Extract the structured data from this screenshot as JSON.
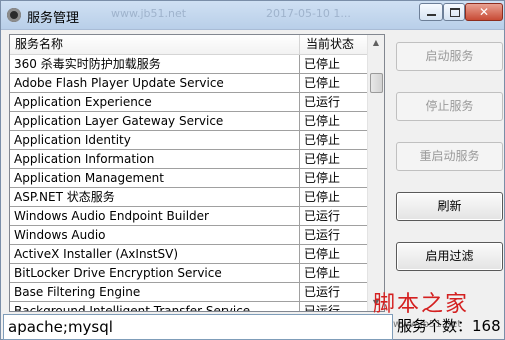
{
  "window": {
    "title": "服务管理",
    "ghost_text_1": "www.jb51.net",
    "ghost_text_2": "2017-05-10 1..."
  },
  "list": {
    "headers": {
      "name": "服务名称",
      "status": "当前状态"
    },
    "rows": [
      {
        "name": "360 杀毒实时防护加载服务",
        "status": "已停止"
      },
      {
        "name": "Adobe Flash Player Update Service",
        "status": "已停止"
      },
      {
        "name": "Application Experience",
        "status": "已运行"
      },
      {
        "name": "Application Layer Gateway Service",
        "status": "已停止"
      },
      {
        "name": "Application Identity",
        "status": "已停止"
      },
      {
        "name": "Application Information",
        "status": "已停止"
      },
      {
        "name": "Application Management",
        "status": "已停止"
      },
      {
        "name": "ASP.NET 状态服务",
        "status": "已停止"
      },
      {
        "name": "Windows Audio Endpoint Builder",
        "status": "已运行"
      },
      {
        "name": "Windows Audio",
        "status": "已运行"
      },
      {
        "name": "ActiveX Installer (AxInstSV)",
        "status": "已停止"
      },
      {
        "name": "BitLocker Drive Encryption Service",
        "status": "已停止"
      },
      {
        "name": "Base Filtering Engine",
        "status": "已运行"
      },
      {
        "name": "Background Intelligent Transfer Service",
        "status": "已运行"
      }
    ]
  },
  "buttons": {
    "start": "启动服务",
    "stop": "停止服务",
    "restart": "重启动服务",
    "refresh": "刷新",
    "filter": "启用过滤"
  },
  "filter_input": {
    "value": "apache;mysql"
  },
  "footer": {
    "watermark": "脚本之家",
    "watermark_sub": "www.jb51.net",
    "count_label": "服务个数：168"
  }
}
